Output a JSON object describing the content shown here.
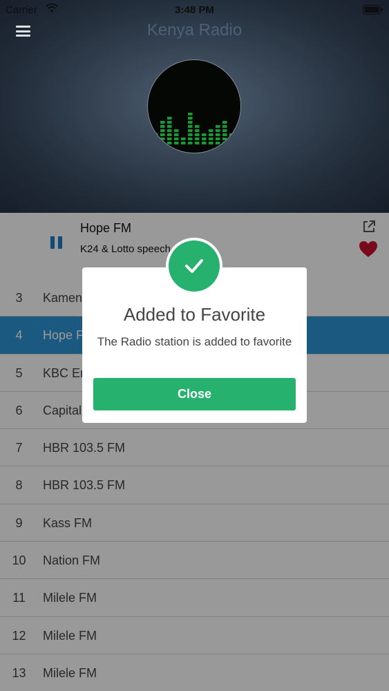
{
  "status_bar": {
    "carrier": "Carrier",
    "time": "3:48 PM"
  },
  "header": {
    "title": "Kenya Radio"
  },
  "now_playing": {
    "title": "Hope FM",
    "subtitle": "K24 & Lotto speech"
  },
  "stations": [
    {
      "num": "3",
      "name": "Kamen"
    },
    {
      "num": "4",
      "name": "Hope FM",
      "selected": true
    },
    {
      "num": "5",
      "name": "KBC English"
    },
    {
      "num": "6",
      "name": "Capital"
    },
    {
      "num": "7",
      "name": "HBR 103.5 FM"
    },
    {
      "num": "8",
      "name": "HBR 103.5 FM"
    },
    {
      "num": "9",
      "name": "Kass FM"
    },
    {
      "num": "10",
      "name": "Nation FM"
    },
    {
      "num": "11",
      "name": "Milele FM"
    },
    {
      "num": "12",
      "name": "Milele FM"
    },
    {
      "num": "13",
      "name": "Milele FM"
    }
  ],
  "dialog": {
    "title": "Added to Favorite",
    "message": "The Radio station is added to favorite",
    "close_label": "Close"
  },
  "colors": {
    "accent_blue": "#2f94d6",
    "success_green": "#27b16f",
    "heart_red": "#c8102e"
  }
}
